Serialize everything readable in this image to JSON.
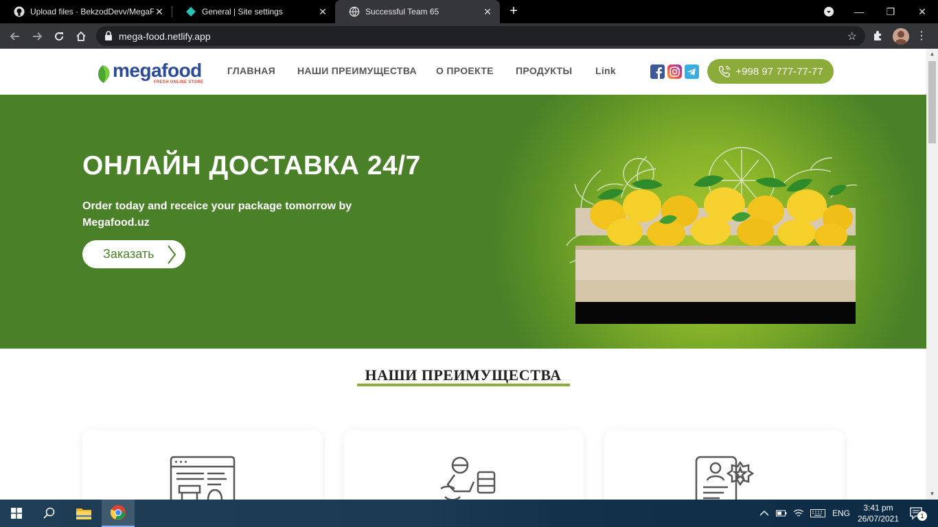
{
  "browser": {
    "tabs": [
      {
        "title": "Upload files · BekzodDevv/MegaF",
        "icon": "github-icon",
        "active": false
      },
      {
        "title": "General | Site settings",
        "icon": "netlify-icon",
        "active": false
      },
      {
        "title": "Successful Team 65",
        "icon": "globe-icon",
        "active": true
      }
    ],
    "url": "mega-food.netlify.app"
  },
  "site": {
    "logo": {
      "word": "megafood",
      "tagline": "FRESH ONLINE STORE"
    },
    "nav": [
      "ГЛАВНАЯ",
      "НАШИ ПРЕИМУЩЕСТВА",
      "О ПРОЕКТЕ",
      "ПРОДУКТЫ",
      "Link"
    ],
    "social": [
      "facebook-icon",
      "instagram-icon",
      "telegram-icon"
    ],
    "phone": "+998 97 777-77-77",
    "hero": {
      "title": "ОНЛАЙН ДОСТАВКА 24/7",
      "subtitle": "Order today and receice your package tomorrow by Megafood.uz",
      "button": "Заказать"
    },
    "advantages": {
      "title": "НАШИ ПРЕИМУЩЕСТВА",
      "cards": [
        {
          "icon": "online-store-icon"
        },
        {
          "icon": "courier-delivery-icon"
        },
        {
          "icon": "certificate-icon"
        }
      ]
    }
  },
  "taskbar": {
    "language": "ENG",
    "time": "3:41 pm",
    "date": "26/07/2021",
    "notifications": "1"
  },
  "colors": {
    "hero_green": "#4a8128",
    "accent_green": "#8bab3a",
    "logo_blue": "#2b4a9a"
  }
}
